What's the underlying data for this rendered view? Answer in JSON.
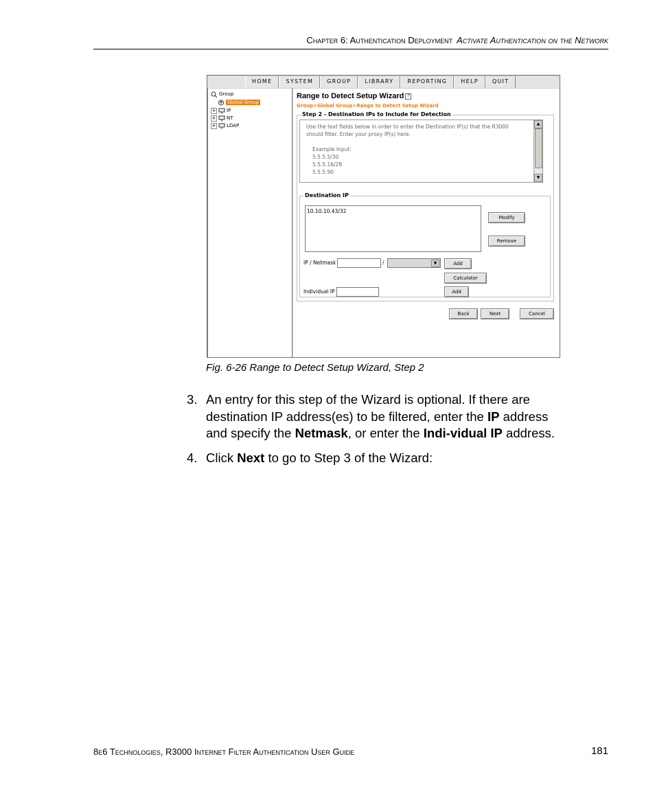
{
  "header": {
    "chapter": "Chapter 6: Authentication Deployment",
    "section": "Activate Authentication on the Network"
  },
  "screenshot": {
    "menu": [
      "HOME",
      "SYSTEM",
      "GROUP",
      "LIBRARY",
      "REPORTING",
      "HELP",
      "QUIT"
    ],
    "tree": {
      "root": "Group",
      "selected": "Global Group",
      "children": [
        "IP",
        "NT",
        "LDAP"
      ]
    },
    "wizard": {
      "title": "Range to Detect Setup Wizard",
      "breadcrumb": "Group>Global Group>Range to Detect Setup Wizard",
      "step_legend": "Step 2 - Destination IPs to Include for Detection",
      "instructions": [
        "Use the text fields below in order to enter the Destination IP(s) that the R3000",
        "should filter. Enter your proxy IP(s) here.",
        "",
        "Example Input:",
        "5.5.5.5/30",
        "5.5.5.16/28",
        "5.5.5.90"
      ],
      "dest_legend": "Destination IP",
      "dest_entries": [
        "10.10.10.43/32"
      ],
      "modify_label": "Modify",
      "remove_label": "Remove",
      "ip_netmask_label": "IP / Netmask",
      "slash": "/",
      "add_label": "Add",
      "calculator_label": "Calculator",
      "individual_ip_label": "Individual IP",
      "add2_label": "Add",
      "back_label": "Back",
      "next_label": "Next",
      "cancel_label": "Cancel"
    }
  },
  "caption": "Fig. 6-26  Range to Detect Setup Wizard, Step 2",
  "steps": [
    {
      "num": "3.",
      "t1": "An entry for this step of the Wizard is optional. If there are destination IP address(es) to be filtered, enter the ",
      "b1": "IP",
      "t2": " address and specify the ",
      "b2": "Netmask",
      "t3": ", or enter the ",
      "b3": "Indi-vidual IP",
      "t4": " address."
    },
    {
      "num": "4.",
      "t1": "Click ",
      "b1": "Next",
      "t2": " to go to Step 3 of the Wizard:"
    }
  ],
  "footer": {
    "left": "8e6 Technologies, R3000 Internet Filter Authentication User Guide",
    "page": "181"
  }
}
